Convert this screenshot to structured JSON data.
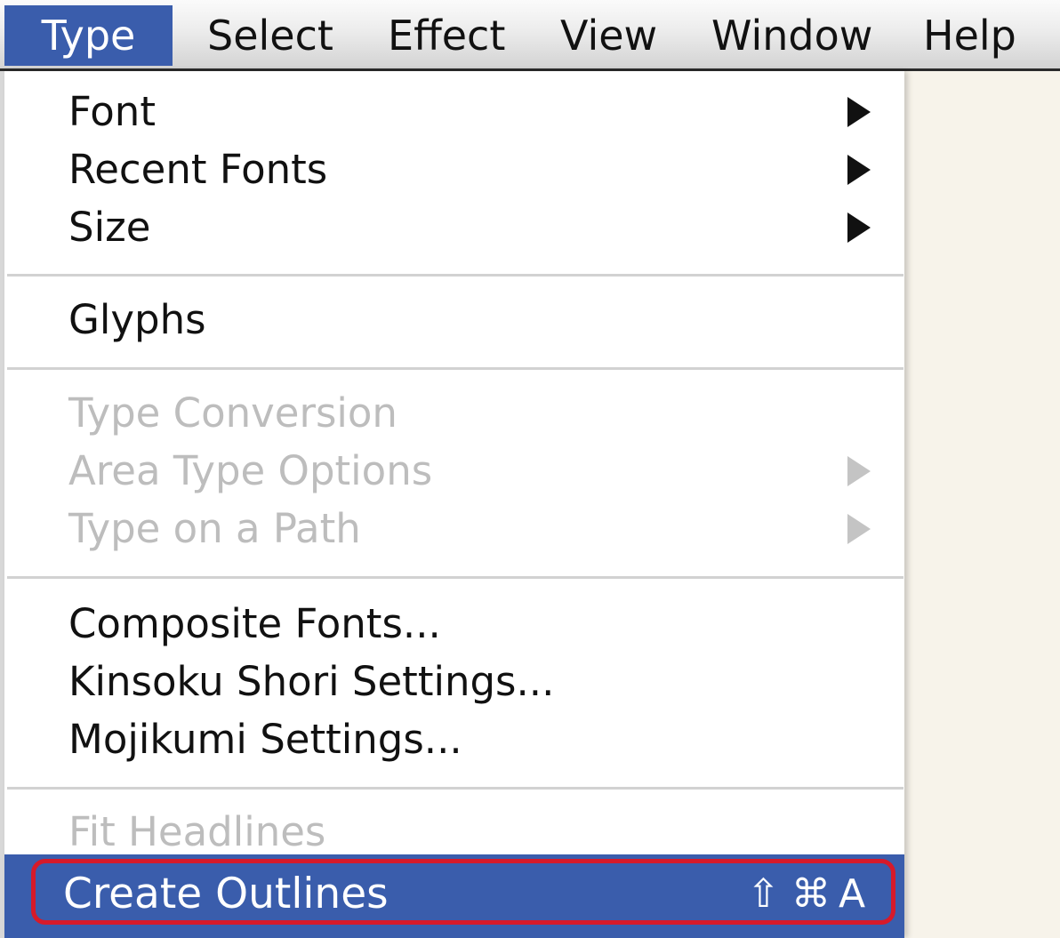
{
  "menubar": {
    "items": [
      {
        "label": "Type"
      },
      {
        "label": "Select"
      },
      {
        "label": "Effect"
      },
      {
        "label": "View"
      },
      {
        "label": "Window"
      },
      {
        "label": "Help"
      }
    ]
  },
  "type_menu": {
    "items": [
      {
        "label": "Font",
        "submenu": true,
        "enabled": true
      },
      {
        "label": "Recent Fonts",
        "submenu": true,
        "enabled": true
      },
      {
        "label": "Size",
        "submenu": true,
        "enabled": true
      },
      {
        "label": "Glyphs",
        "submenu": false,
        "enabled": true
      },
      {
        "label": "Type Conversion",
        "submenu": false,
        "enabled": false
      },
      {
        "label": "Area Type Options",
        "submenu": true,
        "enabled": false
      },
      {
        "label": "Type on a Path",
        "submenu": true,
        "enabled": false
      },
      {
        "label": "Composite Fonts...",
        "submenu": false,
        "enabled": true
      },
      {
        "label": "Kinsoku Shori Settings...",
        "submenu": false,
        "enabled": true
      },
      {
        "label": "Mojikumi Settings...",
        "submenu": false,
        "enabled": true
      },
      {
        "label": "Fit Headlines",
        "submenu": false,
        "enabled": false
      },
      {
        "label": "Create Outlines",
        "submenu": false,
        "enabled": true,
        "highlighted": true
      }
    ],
    "create_outlines_shortcut": {
      "shift": "⇧",
      "command": "⌘",
      "key": "A"
    }
  },
  "colors": {
    "highlight": "#3a5dac",
    "annotation": "#d61a2a",
    "disabled_text": "#bdbdbd"
  },
  "icons": {
    "submenu": "triangle-right-icon"
  }
}
